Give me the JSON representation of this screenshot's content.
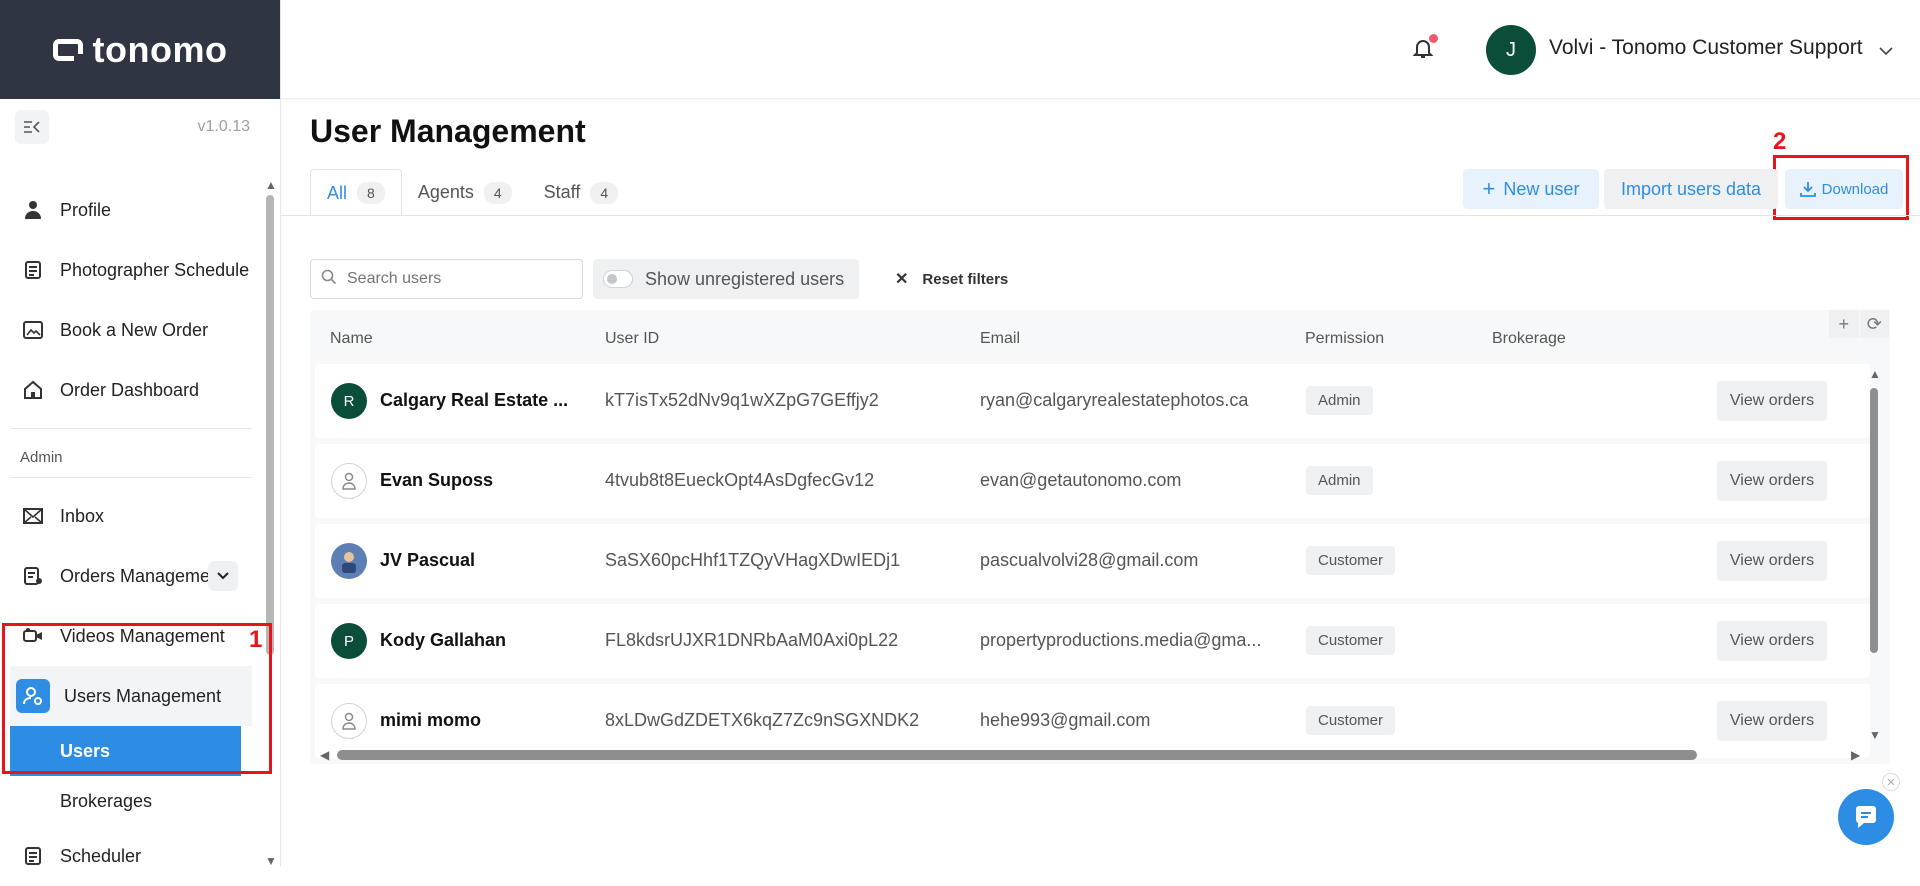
{
  "app": {
    "logo_text": "tonomo",
    "version": "v1.0.13"
  },
  "sidebar": {
    "items": [
      {
        "label": "Profile"
      },
      {
        "label": "Photographer Schedule"
      },
      {
        "label": "Book a New Order"
      },
      {
        "label": "Order Dashboard"
      }
    ],
    "admin_label": "Admin",
    "admin_items": [
      {
        "label": "Inbox"
      },
      {
        "label": "Orders Manageme"
      },
      {
        "label": "Videos Management"
      },
      {
        "label": "Users Management"
      }
    ],
    "sub_items": [
      {
        "label": "Users"
      },
      {
        "label": "Brokerages"
      }
    ],
    "scheduler_label": "Scheduler"
  },
  "annotations": {
    "one": "1",
    "two": "2"
  },
  "header": {
    "avatar_letter": "J",
    "user_name": "Volvi - Tonomo Customer Support"
  },
  "page": {
    "title": "User Management"
  },
  "tabs": [
    {
      "label": "All",
      "count": "8"
    },
    {
      "label": "Agents",
      "count": "4"
    },
    {
      "label": "Staff",
      "count": "4"
    }
  ],
  "actions": {
    "new_user": "New user",
    "import": "Import users data",
    "download": "Download"
  },
  "filters": {
    "search_placeholder": "Search users",
    "toggle_label": "Show unregistered users",
    "reset_label": "Reset filters"
  },
  "table": {
    "columns": [
      "Name",
      "User ID",
      "Email",
      "Permission",
      "Brokerage"
    ],
    "view_label": "View orders",
    "rows": [
      {
        "avatar": "R",
        "name": "Calgary Real Estate ...",
        "user_id": "kT7isTx52dNv9q1wXZpG7GEffjy2",
        "email": "ryan@calgaryrealestatephotos.ca",
        "permission": "Admin"
      },
      {
        "avatar": "",
        "name": "Evan Suposs",
        "user_id": "4tvub8t8EueckOpt4AsDgfecGv12",
        "email": "evan@getautonomo.com",
        "permission": "Admin"
      },
      {
        "avatar": "",
        "name": "JV Pascual",
        "user_id": "SaSX60pcHhf1TZQyVHagXDwIEDj1",
        "email": "pascualvolvi28@gmail.com",
        "permission": "Customer"
      },
      {
        "avatar": "P",
        "name": "Kody Gallahan",
        "user_id": "FL8kdsrUJXR1DNRbAaM0Axi0pL22",
        "email": "propertyproductions.media@gma...",
        "permission": "Customer"
      },
      {
        "avatar": "",
        "name": "mimi momo",
        "user_id": "8xLDwGdZDETX6kqZ7Zc9nSGXNDK2",
        "email": "hehe993@gmail.com",
        "permission": "Customer"
      }
    ]
  },
  "colors": {
    "accent": "#2d8ce3",
    "annotation": "#e8131b",
    "sidebar_header": "#2f3542",
    "avatar": "#0b4d3b"
  }
}
